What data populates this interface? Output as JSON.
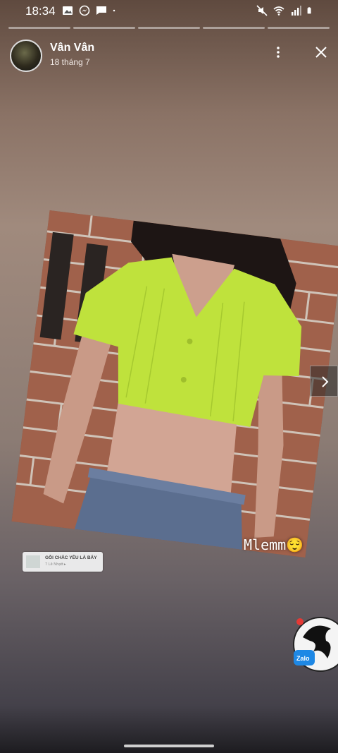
{
  "status_bar": {
    "time": "18:34",
    "left_icons": [
      "image-icon",
      "messenger-icon",
      "chat-icon",
      "dot-icon"
    ],
    "right_icons": [
      "mute-icon",
      "wifi-icon",
      "signal-icon",
      "battery-icon"
    ]
  },
  "story": {
    "segment_count": 5,
    "user_name": "Vân Vân",
    "date": "18 tháng 7",
    "caption": "Mlemm😌",
    "sticker_title": "GỖI CHẮC YÊU LÀ BẢY",
    "sticker_subtitle": "7 Lê Nhạtt ▸"
  },
  "badge": {
    "label": "Zalo"
  }
}
